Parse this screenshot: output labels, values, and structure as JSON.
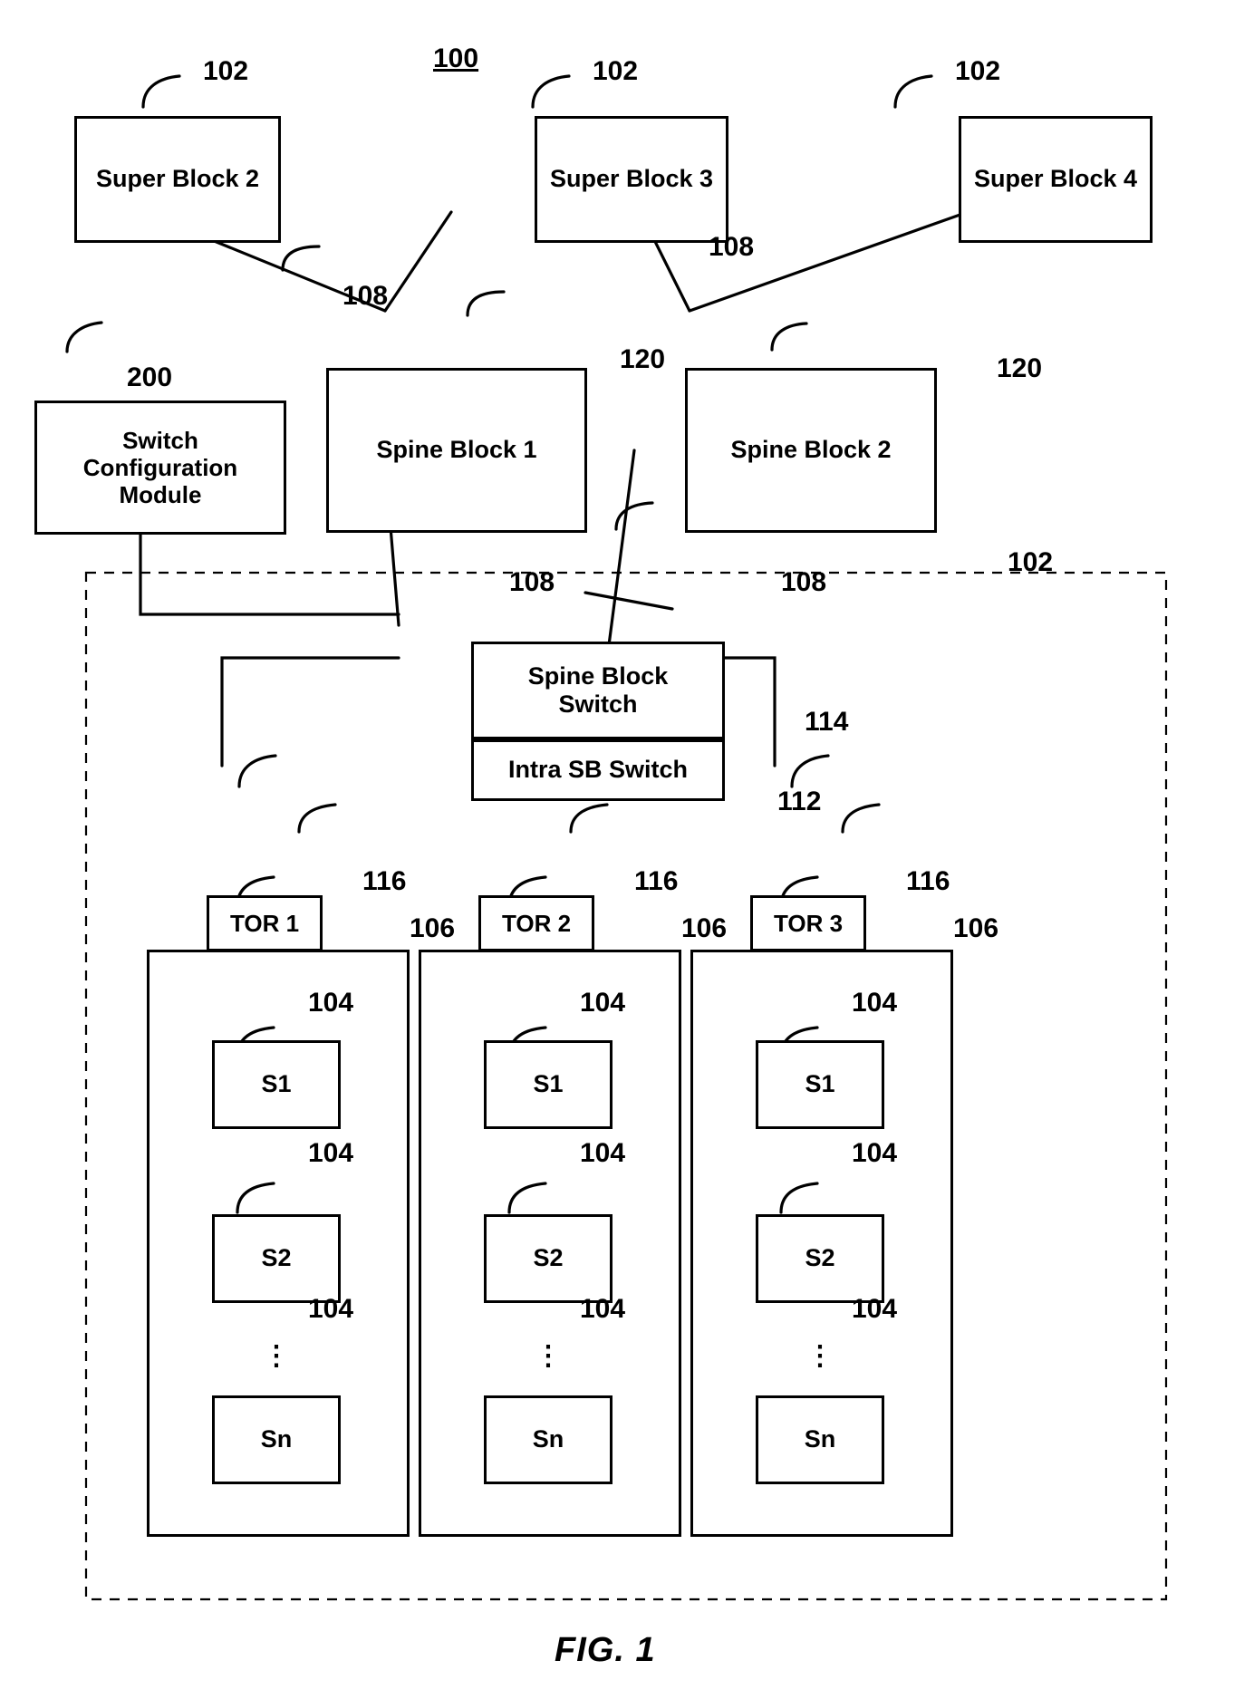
{
  "figure": {
    "number": "100",
    "caption": "FIG. 1"
  },
  "super_blocks": [
    {
      "label": "Super Block 2",
      "ref": "102"
    },
    {
      "label": "Super Block 3",
      "ref": "102"
    },
    {
      "label": "Super Block 4",
      "ref": "102"
    }
  ],
  "spine_blocks": [
    {
      "label": "Spine Block 1",
      "ref": "120"
    },
    {
      "label": "Spine Block 2",
      "ref": "120"
    }
  ],
  "switch_configuration_module": {
    "label": "Switch Configuration Module",
    "line1": "Switch",
    "line2": "Configuration",
    "line3": "Module",
    "ref": "200"
  },
  "super_block_detail": {
    "ref": "102",
    "spine_block_switch": {
      "line1": "Spine Block",
      "line2": "Switch",
      "label": "Spine Block Switch",
      "ref": "114"
    },
    "intra_sb_switch": {
      "label": "Intra SB Switch",
      "ref": "112"
    },
    "racks": [
      {
        "tor": {
          "label": "TOR 1",
          "ref": "116"
        },
        "rack_ref": "106",
        "servers": [
          {
            "label": "S1",
            "ref": "104"
          },
          {
            "label": "S2",
            "ref": "104"
          },
          {
            "label": "Sn",
            "ref": "104"
          }
        ],
        "ellipsis": "⋮"
      },
      {
        "tor": {
          "label": "TOR 2",
          "ref": "116"
        },
        "rack_ref": "106",
        "servers": [
          {
            "label": "S1",
            "ref": "104"
          },
          {
            "label": "S2",
            "ref": "104"
          },
          {
            "label": "Sn",
            "ref": "104"
          }
        ],
        "ellipsis": "⋮"
      },
      {
        "tor": {
          "label": "TOR 3",
          "ref": "116"
        },
        "rack_ref": "106",
        "servers": [
          {
            "label": "S1",
            "ref": "104"
          },
          {
            "label": "S2",
            "ref": "104"
          },
          {
            "label": "Sn",
            "ref": "104"
          }
        ],
        "ellipsis": "⋮"
      }
    ]
  },
  "link_refs": {
    "left_uplink": "108",
    "mid_uplink": "108",
    "spine1_down": "108",
    "spine2_down": "108"
  },
  "colors": {
    "line": "#000000",
    "background": "#ffffff"
  }
}
